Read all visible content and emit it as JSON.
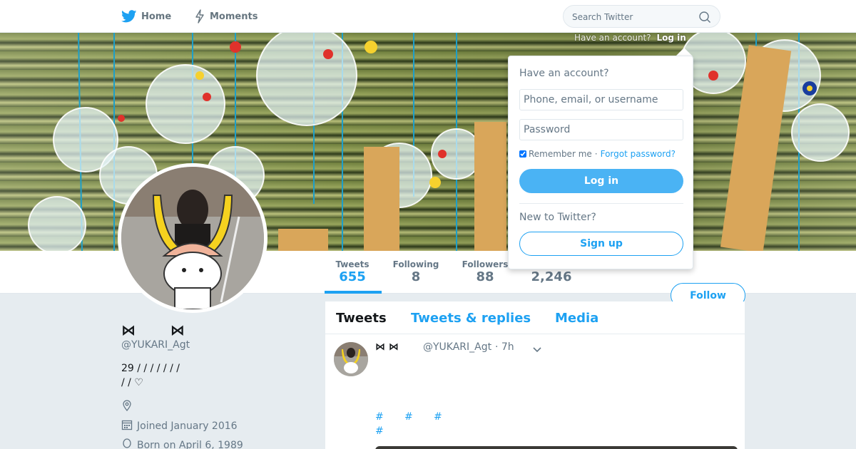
{
  "nav": {
    "home_label": "Home",
    "moments_label": "Moments",
    "search_placeholder": "Search Twitter"
  },
  "header_login": {
    "have_account": "Have an account?",
    "login_link": "Log in"
  },
  "stats": {
    "tweets_label": "Tweets",
    "tweets_value": "655",
    "following_label": "Following",
    "following_value": "8",
    "followers_label": "Followers",
    "followers_value": "88",
    "likes_value": "2,246"
  },
  "follow_label": "Follow",
  "profile": {
    "name": "⋈       ⋈",
    "handle": "@YUKARI_Agt",
    "bio_line1": "29 / / / / / / /",
    "bio_line2": " / / ♡",
    "joined": "Joined January 2016",
    "born": "Born on April 6, 1989"
  },
  "tabs": {
    "tweets": "Tweets",
    "replies": "Tweets & replies",
    "media": "Media"
  },
  "tweet": {
    "name": "⋈ ⋈",
    "handle": "@YUKARI_Agt",
    "time": "· 7h",
    "hashtags": [
      "#",
      "#",
      "#",
      "#"
    ]
  },
  "login_popup": {
    "title": "Have an account?",
    "username_placeholder": "Phone, email, or username",
    "password_placeholder": "Password",
    "remember": "Remember me",
    "separator": "·",
    "forgot": "Forgot password?",
    "login_button": "Log in",
    "new_to": "New to Twitter?",
    "signup_button": "Sign up"
  },
  "colors": {
    "brand": "#1da1f2",
    "login_button": "#4ab3f4",
    "background": "#e6ecf0"
  },
  "icons": [
    "twitter-bird-icon",
    "lightning-icon",
    "search-icon",
    "location-icon",
    "calendar-icon",
    "balloon-icon",
    "chevron-down-icon"
  ]
}
